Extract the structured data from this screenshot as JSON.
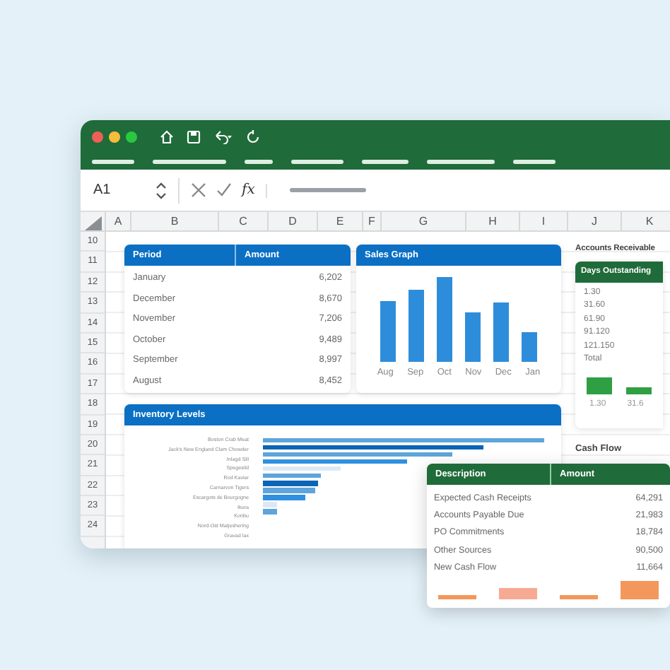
{
  "formula_bar": {
    "cell_ref": "A1",
    "function_label": "fx"
  },
  "columns": [
    "A",
    "B",
    "C",
    "D",
    "E",
    "F",
    "G",
    "H",
    "I",
    "J",
    "K"
  ],
  "rows": [
    "10",
    "11",
    "12",
    "13",
    "14",
    "15",
    "16",
    "17",
    "18",
    "19",
    "20",
    "21",
    "22",
    "23",
    "24"
  ],
  "period_table": {
    "columns": [
      "Period",
      "Amount"
    ],
    "rows": [
      {
        "period": "January",
        "amount": "6,202"
      },
      {
        "period": "December",
        "amount": "8,670"
      },
      {
        "period": "November",
        "amount": "7,206"
      },
      {
        "period": "October",
        "amount": "9,489"
      },
      {
        "period": "September",
        "amount": "8,997"
      },
      {
        "period": "August",
        "amount": "8,452"
      }
    ]
  },
  "sales_graph": {
    "title": "Sales Graph",
    "categories": [
      "Aug",
      "Sep",
      "Oct",
      "Nov",
      "Dec",
      "Jan"
    ]
  },
  "inventory": {
    "title": "Inventory Levels",
    "items": [
      "Boston Crab Meat",
      "Jack's New England Clam Chowder",
      "Inlagd Sill",
      "Spegesild",
      "Rod Kaviar",
      "Carnarvon Tigers",
      "Escargots de Bourgogne",
      "Ikura",
      "Konbu",
      "Nord-Ost Matjeshering",
      "Gravad lax"
    ]
  },
  "accounts_receivable": {
    "title": "Accounts Receivable",
    "header": "Days Outstanding",
    "rows": [
      "1.30",
      "31.60",
      "61.90",
      "91.120",
      "121.150",
      "Total"
    ],
    "bar_labels": [
      "1.30",
      "31.6"
    ]
  },
  "cash_flow": {
    "title": "Cash Flow"
  },
  "cash_flow_table": {
    "columns": [
      "Description",
      "Amount"
    ],
    "rows": [
      {
        "description": "Expected Cash Receipts",
        "amount": "64,291"
      },
      {
        "description": "Accounts Payable Due",
        "amount": "21,983"
      },
      {
        "description": "PO Commitments",
        "amount": "18,784"
      },
      {
        "description": "Other Sources",
        "amount": "90,500"
      },
      {
        "description": "New Cash Flow",
        "amount": "11,664"
      }
    ]
  }
}
